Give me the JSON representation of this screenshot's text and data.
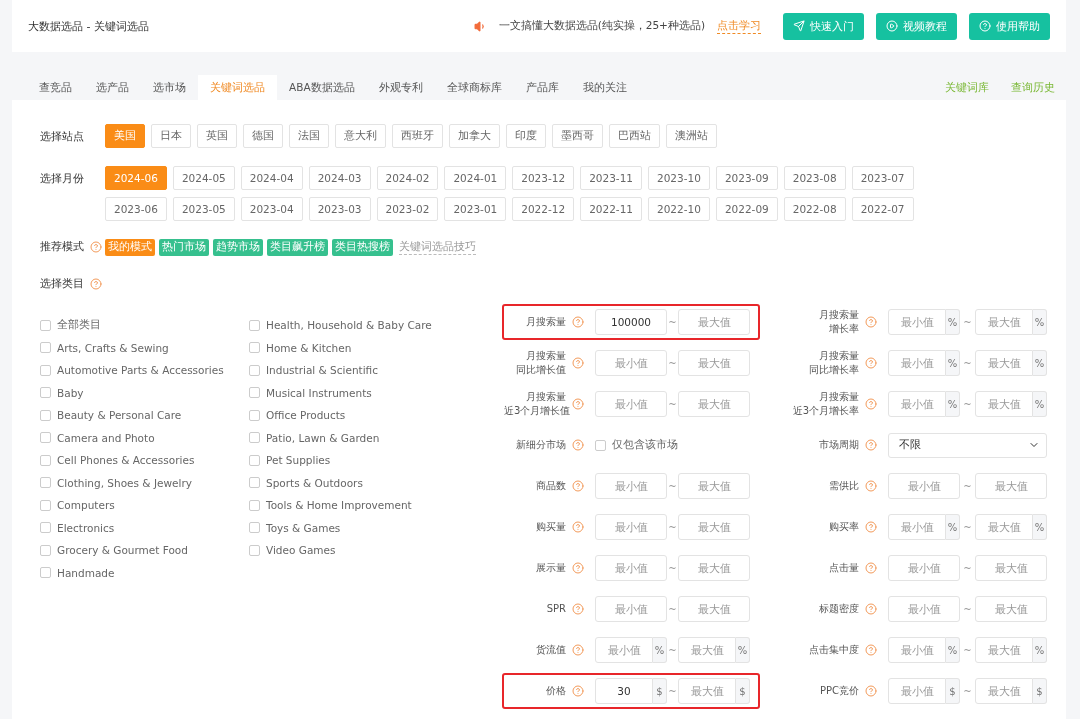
{
  "header": {
    "title": "大数据选品 - 关键词选品",
    "notice": "一文搞懂大数据选品(纯实操，25+种选品)",
    "notice_link": "点击学习",
    "buttons": [
      {
        "label": "快速入门",
        "kind": "send"
      },
      {
        "label": "视频教程",
        "kind": "play"
      },
      {
        "label": "使用帮助",
        "kind": "help"
      }
    ]
  },
  "tabs": [
    {
      "label": "查竞品",
      "selected": false
    },
    {
      "label": "选产品",
      "selected": false
    },
    {
      "label": "选市场",
      "selected": false
    },
    {
      "label": "关键词选品",
      "selected": true
    },
    {
      "label": "ABA数据选品",
      "selected": false
    },
    {
      "label": "外观专利",
      "selected": false
    },
    {
      "label": "全球商标库",
      "selected": false
    },
    {
      "label": "产品库",
      "selected": false
    },
    {
      "label": "我的关注",
      "selected": false
    }
  ],
  "tab_links": [
    "关键词库",
    "查询历史"
  ],
  "sites": {
    "label": "选择站点",
    "items": [
      {
        "label": "美国",
        "selected": true
      },
      {
        "label": "日本",
        "selected": false
      },
      {
        "label": "英国",
        "selected": false
      },
      {
        "label": "德国",
        "selected": false
      },
      {
        "label": "法国",
        "selected": false
      },
      {
        "label": "意大利",
        "selected": false
      },
      {
        "label": "西班牙",
        "selected": false
      },
      {
        "label": "加拿大",
        "selected": false
      },
      {
        "label": "印度",
        "selected": false
      },
      {
        "label": "墨西哥",
        "selected": false
      },
      {
        "label": "巴西站",
        "selected": false
      },
      {
        "label": "澳洲站",
        "selected": false
      }
    ]
  },
  "months": {
    "label": "选择月份",
    "items": [
      {
        "label": "2024-06",
        "selected": true
      },
      {
        "label": "2024-05",
        "selected": false
      },
      {
        "label": "2024-04",
        "selected": false
      },
      {
        "label": "2024-03",
        "selected": false
      },
      {
        "label": "2024-02",
        "selected": false
      },
      {
        "label": "2024-01",
        "selected": false
      },
      {
        "label": "2023-12",
        "selected": false
      },
      {
        "label": "2023-11",
        "selected": false
      },
      {
        "label": "2023-10",
        "selected": false
      },
      {
        "label": "2023-09",
        "selected": false
      },
      {
        "label": "2023-08",
        "selected": false
      },
      {
        "label": "2023-07",
        "selected": false
      },
      {
        "label": "2023-06",
        "selected": false
      },
      {
        "label": "2023-05",
        "selected": false
      },
      {
        "label": "2023-04",
        "selected": false
      },
      {
        "label": "2023-03",
        "selected": false
      },
      {
        "label": "2023-02",
        "selected": false
      },
      {
        "label": "2023-01",
        "selected": false
      },
      {
        "label": "2022-12",
        "selected": false
      },
      {
        "label": "2022-11",
        "selected": false
      },
      {
        "label": "2022-10",
        "selected": false
      },
      {
        "label": "2022-09",
        "selected": false
      },
      {
        "label": "2022-08",
        "selected": false
      },
      {
        "label": "2022-07",
        "selected": false
      }
    ]
  },
  "modes": {
    "label": "推荐模式",
    "tags": [
      {
        "label": "我的模式",
        "color": "#fa8c16"
      },
      {
        "label": "热门市场",
        "color": "#36c08e"
      },
      {
        "label": "趋势市场",
        "color": "#36c08e"
      },
      {
        "label": "类目飙升榜",
        "color": "#36c08e"
      },
      {
        "label": "类目热搜榜",
        "color": "#36c08e"
      }
    ],
    "tip": "关键词选品技巧"
  },
  "category": {
    "label": "选择类目",
    "columns": [
      [
        {
          "label": "全部类目",
          "checked": false
        },
        {
          "label": "Arts, Crafts & Sewing",
          "checked": false
        },
        {
          "label": "Automotive Parts & Accessories",
          "checked": false
        },
        {
          "label": "Baby",
          "checked": false
        },
        {
          "label": "Beauty & Personal Care",
          "checked": false
        },
        {
          "label": "Camera and Photo",
          "checked": false
        },
        {
          "label": "Cell Phones & Accessories",
          "checked": false
        },
        {
          "label": "Clothing, Shoes & Jewelry",
          "checked": false
        },
        {
          "label": "Computers",
          "checked": false
        },
        {
          "label": "Electronics",
          "checked": false
        },
        {
          "label": "Grocery & Gourmet Food",
          "checked": false
        },
        {
          "label": "Handmade",
          "checked": false
        }
      ],
      [
        {
          "label": "Health, Household & Baby Care",
          "checked": false
        },
        {
          "label": "Home & Kitchen",
          "checked": false
        },
        {
          "label": "Industrial & Scientific",
          "checked": false
        },
        {
          "label": "Musical Instruments",
          "checked": false
        },
        {
          "label": "Office Products",
          "checked": false
        },
        {
          "label": "Patio, Lawn & Garden",
          "checked": false
        },
        {
          "label": "Pet Supplies",
          "checked": false
        },
        {
          "label": "Sports & Outdoors",
          "checked": false
        },
        {
          "label": "Tools & Home Improvement",
          "checked": false
        },
        {
          "label": "Toys & Games",
          "checked": false
        },
        {
          "label": "Video Games",
          "checked": false
        }
      ]
    ]
  },
  "filters": [
    [
      {
        "kind": "range",
        "label": [
          "月搜索量"
        ],
        "min": {
          "value": "100000"
        },
        "separator": "~",
        "max": {
          "placeholder": "最大值"
        },
        "highlighted": true
      },
      {
        "kind": "range",
        "label": [
          "月搜索量",
          "增长率"
        ],
        "unit": "%",
        "min": {
          "placeholder": "最小值"
        },
        "separator": "~",
        "max": {
          "placeholder": "最大值"
        },
        "highlighted": false
      }
    ],
    [
      {
        "kind": "range",
        "label": [
          "月搜索量",
          "同比增长值"
        ],
        "min": {
          "placeholder": "最小值"
        },
        "separator": "~",
        "max": {
          "placeholder": "最大值"
        },
        "highlighted": false
      },
      {
        "kind": "range",
        "label": [
          "月搜索量",
          "同比增长率"
        ],
        "unit": "%",
        "min": {
          "placeholder": "最小值"
        },
        "separator": "~",
        "max": {
          "placeholder": "最大值"
        },
        "highlighted": false
      }
    ],
    [
      {
        "kind": "range",
        "label": [
          "月搜索量",
          "近3个月增长值"
        ],
        "min": {
          "placeholder": "最小值"
        },
        "separator": "~",
        "max": {
          "placeholder": "最大值"
        },
        "highlighted": false
      },
      {
        "kind": "range",
        "label": [
          "月搜索量",
          "近3个月增长率"
        ],
        "unit": "%",
        "min": {
          "placeholder": "最小值"
        },
        "separator": "~",
        "max": {
          "placeholder": "最大值"
        },
        "highlighted": false
      }
    ],
    [
      {
        "kind": "checkbox",
        "label": [
          "新细分市场"
        ],
        "option": "仅包含该市场",
        "checked": false,
        "highlighted": false
      },
      {
        "kind": "select",
        "label": [
          "市场周期"
        ],
        "value": "不限",
        "highlighted": false
      }
    ],
    [
      {
        "kind": "range",
        "label": [
          "商品数"
        ],
        "min": {
          "placeholder": "最小值"
        },
        "separator": "~",
        "max": {
          "placeholder": "最大值"
        },
        "highlighted": false
      },
      {
        "kind": "range",
        "label": [
          "需供比"
        ],
        "min": {
          "placeholder": "最小值"
        },
        "separator": "~",
        "max": {
          "placeholder": "最大值"
        },
        "highlighted": false
      }
    ],
    [
      {
        "kind": "range",
        "label": [
          "购买量"
        ],
        "min": {
          "placeholder": "最小值"
        },
        "separator": "~",
        "max": {
          "placeholder": "最大值"
        },
        "highlighted": false
      },
      {
        "kind": "range",
        "label": [
          "购买率"
        ],
        "unit": "%",
        "min": {
          "placeholder": "最小值"
        },
        "separator": "~",
        "max": {
          "placeholder": "最大值"
        },
        "highlighted": false
      }
    ],
    [
      {
        "kind": "range",
        "label": [
          "展示量"
        ],
        "min": {
          "placeholder": "最小值"
        },
        "separator": "~",
        "max": {
          "placeholder": "最大值"
        },
        "highlighted": false
      },
      {
        "kind": "range",
        "label": [
          "点击量"
        ],
        "min": {
          "placeholder": "最小值"
        },
        "separator": "~",
        "max": {
          "placeholder": "最大值"
        },
        "highlighted": false
      }
    ],
    [
      {
        "kind": "range",
        "label": [
          "SPR"
        ],
        "min": {
          "placeholder": "最小值"
        },
        "separator": "~",
        "max": {
          "placeholder": "最大值"
        },
        "highlighted": false
      },
      {
        "kind": "range",
        "label": [
          "标题密度"
        ],
        "min": {
          "placeholder": "最小值"
        },
        "separator": "~",
        "max": {
          "placeholder": "最大值"
        },
        "highlighted": false
      }
    ],
    [
      {
        "kind": "range",
        "label": [
          "货流值"
        ],
        "unit": "%",
        "min": {
          "placeholder": "最小值"
        },
        "separator": "~",
        "max": {
          "placeholder": "最大值"
        },
        "highlighted": false
      },
      {
        "kind": "range",
        "label": [
          "点击集中度"
        ],
        "unit": "%",
        "min": {
          "placeholder": "最小值"
        },
        "separator": "~",
        "max": {
          "placeholder": "最大值"
        },
        "highlighted": false
      }
    ],
    [
      {
        "kind": "range",
        "label": [
          "价格"
        ],
        "unit": "$",
        "min": {
          "value": "30"
        },
        "separator": "~",
        "max": {
          "placeholder": "最大值"
        },
        "highlighted": true
      },
      {
        "kind": "range",
        "label": [
          "PPC竞价"
        ],
        "unit": "$",
        "min": {
          "placeholder": "最小值"
        },
        "separator": "~",
        "max": {
          "placeholder": "最大值"
        },
        "highlighted": false
      }
    ]
  ]
}
